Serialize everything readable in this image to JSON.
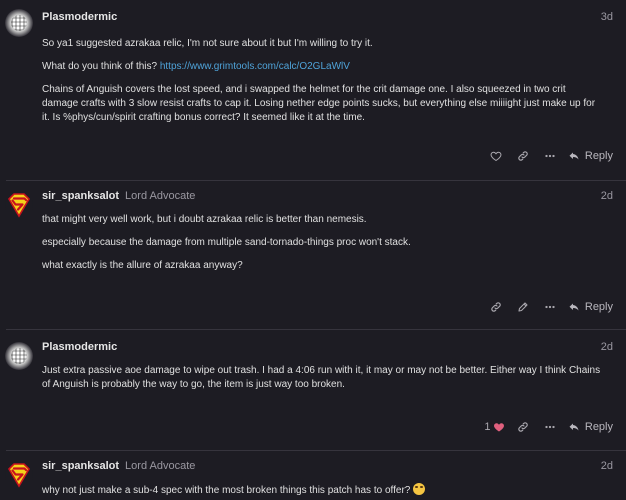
{
  "posts": [
    {
      "username": "Plasmodermic",
      "user_title": "",
      "age": "3d",
      "paragraphs": [
        "So ya1 suggested azrakaa relic, I'm not sure about it but I'm willing to try it.",
        "What do you think of this? ",
        "Chains of Anguish covers the lost speed, and i swapped the helmet for the crit damage one. I also squeezed in two crit damage crafts with 3 slow resist crafts to cap it. Losing nether edge points sucks, but everything else miiiight just make up for it. Is %phys/cun/spirit crafting bonus correct? It seemed like it at the time."
      ],
      "link": "https://www.grimtools.com/calc/O2GLaWlV",
      "reply_label": "Reply"
    },
    {
      "username": "sir_spanksalot",
      "user_title": "Lord Advocate",
      "age": "2d",
      "paragraphs": [
        "that might very well work, but i doubt azrakaa relic is better than nemesis.",
        "especially because the damage from multiple sand-tornado-things proc won't stack.",
        "what exactly is the allure of azrakaa anyway?"
      ],
      "reply_label": "Reply"
    },
    {
      "username": "Plasmodermic",
      "user_title": "",
      "age": "2d",
      "paragraphs": [
        "Just extra passive aoe damage to wipe out trash. I had a 4:06 run with it, it may or may not be better. Either way I think Chains of Anguish is probably the way to go, the item is just way too broken."
      ],
      "like_count": "1",
      "reply_label": "Reply"
    },
    {
      "username": "sir_spanksalot",
      "user_title": "Lord Advocate",
      "age": "2d",
      "paragraphs": [
        "why not just make a sub-4 spec with the most broken things this patch has to offer? "
      ],
      "emoji_name": "rofl-emoji"
    }
  ],
  "colors": {
    "background": "#1d1c23",
    "link": "#4fa3d9",
    "heart": "#e0607e",
    "muted": "#9a98a1"
  }
}
